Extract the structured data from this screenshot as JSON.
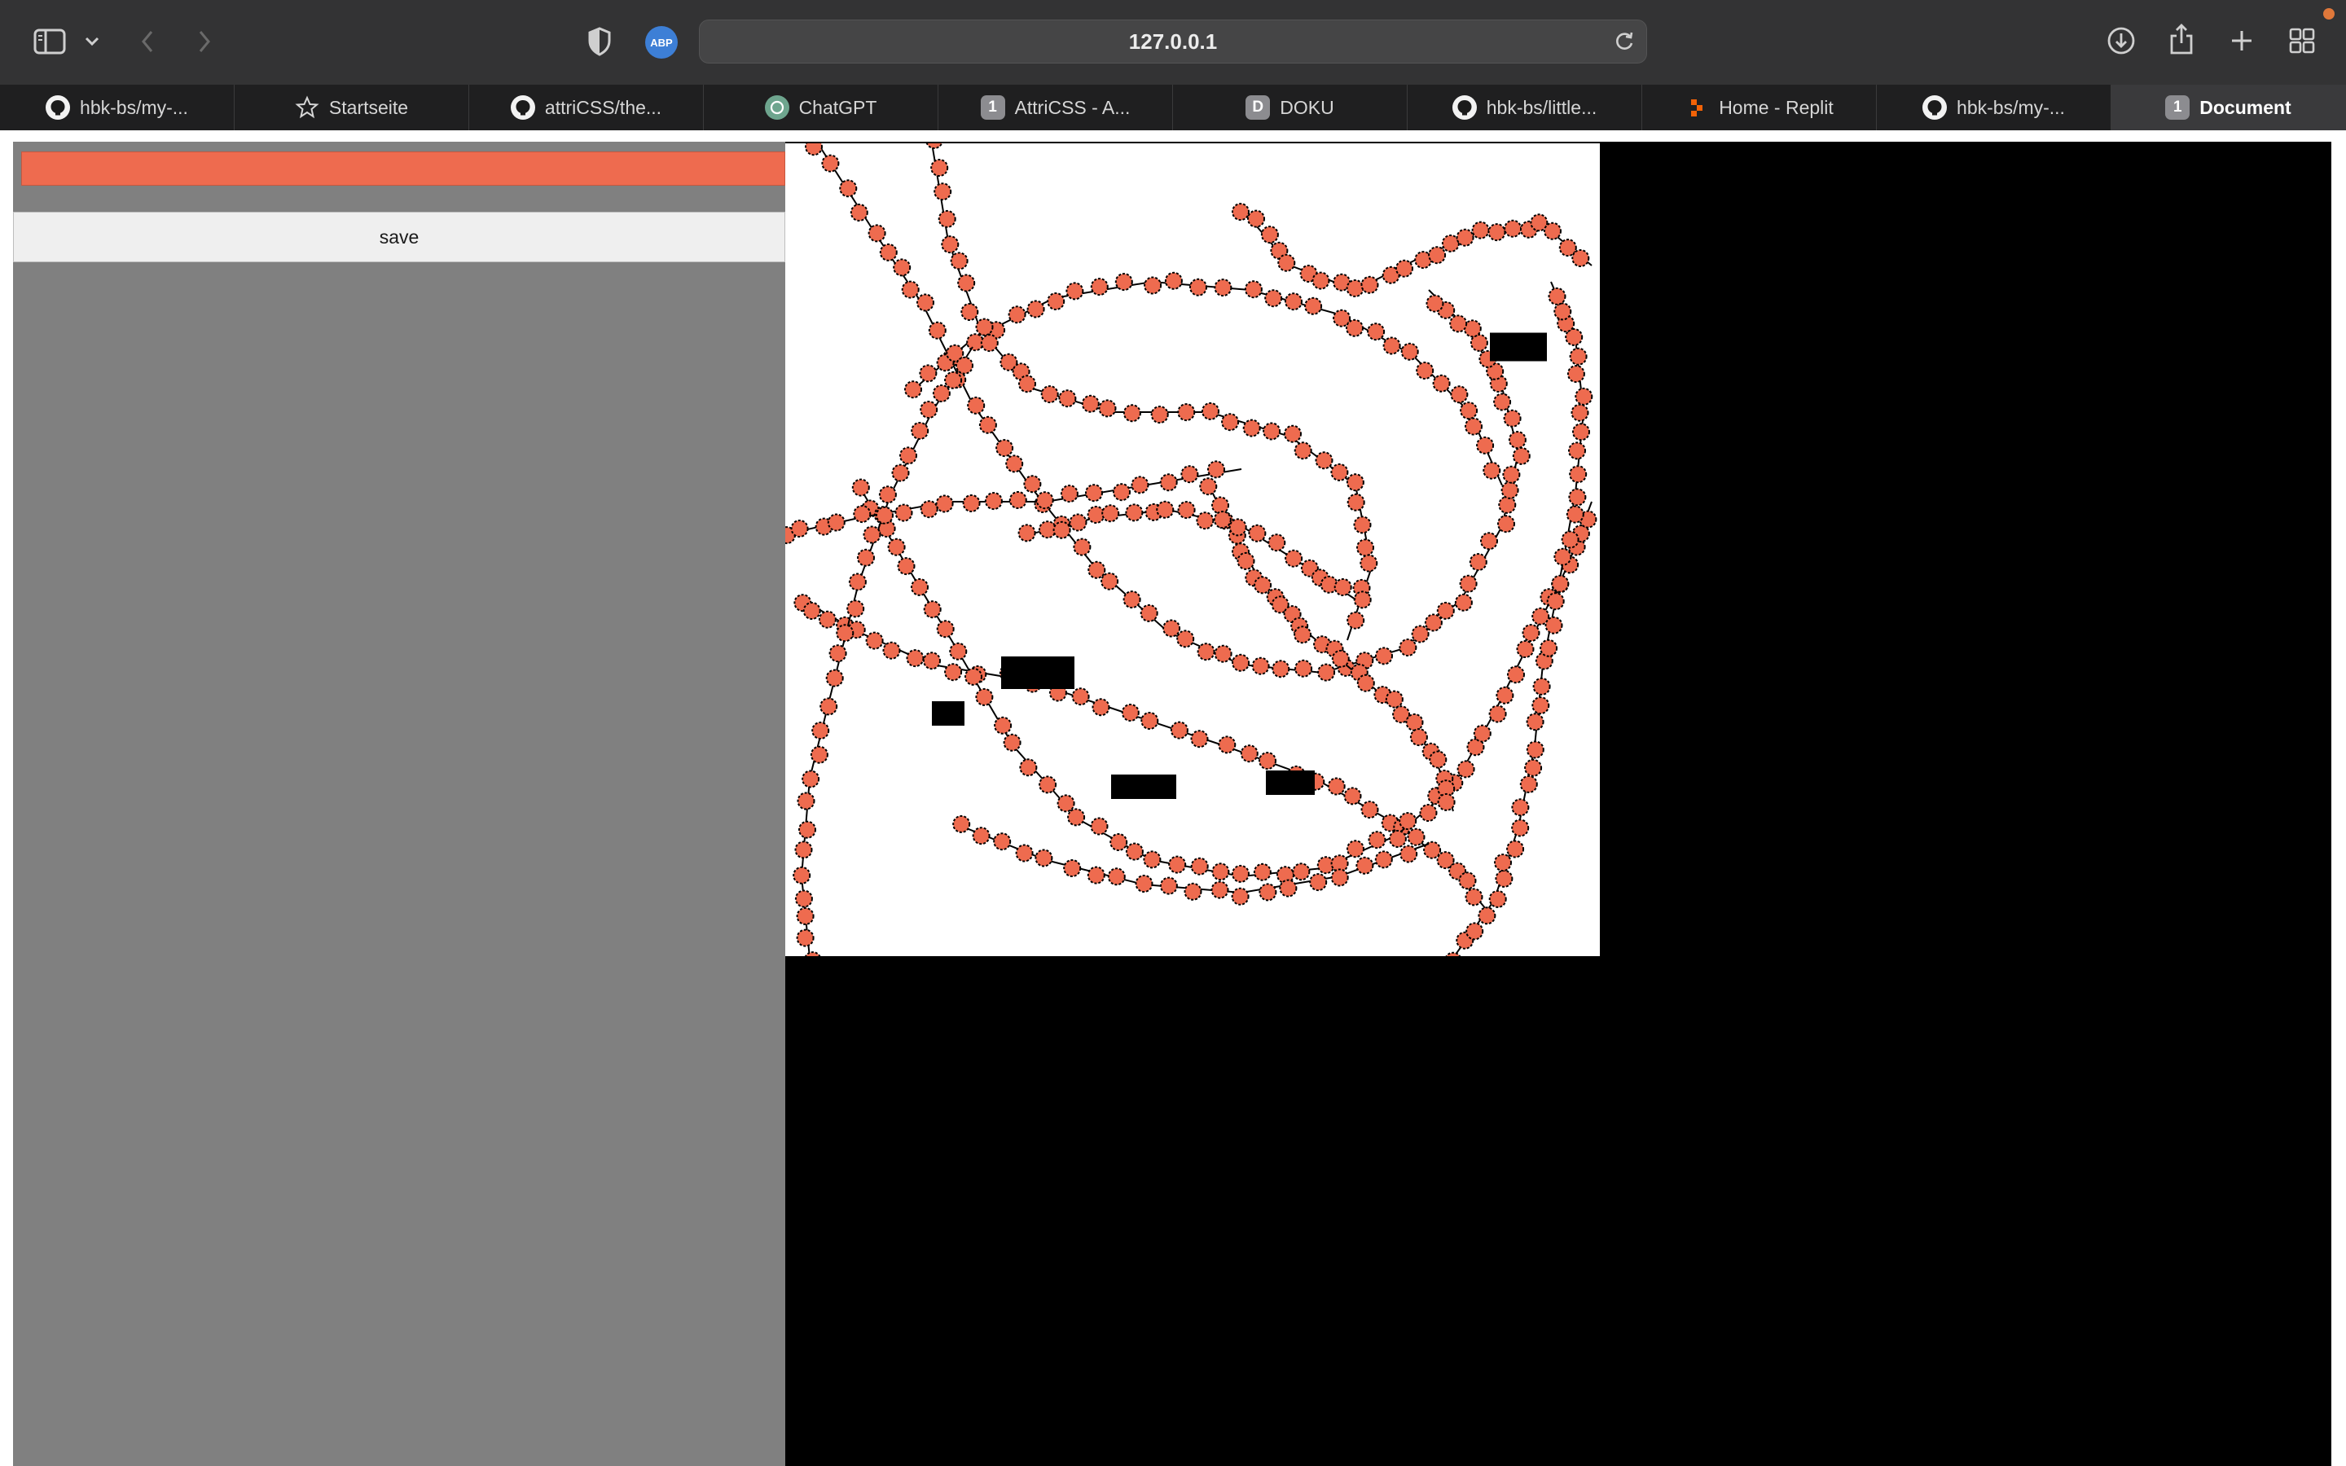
{
  "browser": {
    "url": "127.0.0.1",
    "toolbar_icons": [
      "sidebar-icon",
      "chevron-down-icon",
      "back-icon",
      "forward-icon",
      "privacy-shield-icon",
      "adblock-icon",
      "reload-icon",
      "download-icon",
      "share-icon",
      "new-tab-icon",
      "tab-overview-icon"
    ],
    "adblock_label": "ABP",
    "tabs": [
      {
        "label": "hbk-bs/my-...",
        "favicon": "github-icon",
        "favicon_text": ""
      },
      {
        "label": "Startseite",
        "favicon": "star-icon",
        "favicon_text": ""
      },
      {
        "label": "attriCSS/the...",
        "favicon": "github-icon",
        "favicon_text": ""
      },
      {
        "label": "ChatGPT",
        "favicon": "chatgpt-icon",
        "favicon_text": ""
      },
      {
        "label": "AttriCSS - A...",
        "favicon": "number-icon",
        "favicon_text": "1"
      },
      {
        "label": "DOKU",
        "favicon": "letter-icon",
        "favicon_text": "D"
      },
      {
        "label": "hbk-bs/little...",
        "favicon": "github-icon",
        "favicon_text": ""
      },
      {
        "label": "Home - Replit",
        "favicon": "replit-icon",
        "favicon_text": ""
      },
      {
        "label": "hbk-bs/my-...",
        "favicon": "github-icon",
        "favicon_text": ""
      },
      {
        "label": "Document",
        "favicon": "number-icon",
        "favicon_text": "1",
        "active": true
      }
    ]
  },
  "app": {
    "color_picker_value": "#ee6b4f",
    "save_label": "save",
    "sidebar_color": "#808080",
    "stage_color": "#000000",
    "canvas_color": "#ffffff"
  }
}
